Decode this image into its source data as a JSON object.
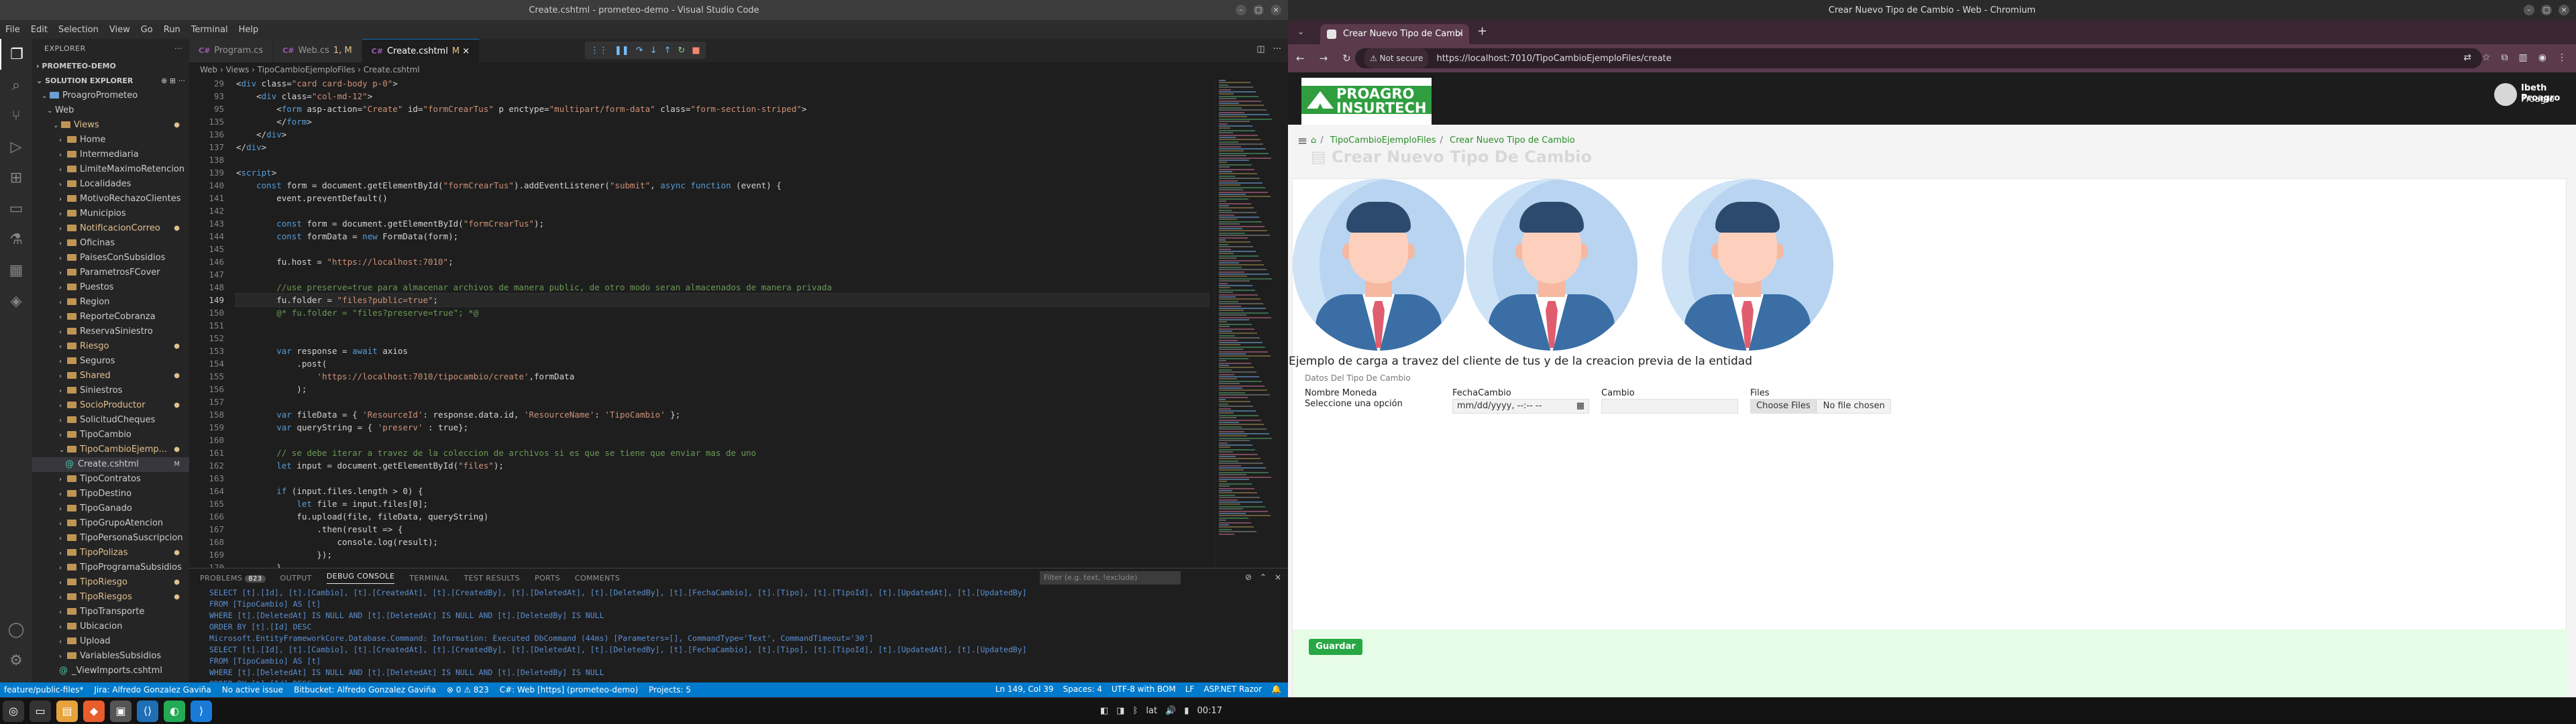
{
  "vscode": {
    "window_title": "Create.cshtml - prometeo-demo - Visual Studio Code",
    "menu": [
      "File",
      "Edit",
      "Selection",
      "View",
      "Go",
      "Run",
      "Terminal",
      "Help"
    ],
    "explorer_title": "EXPLORER",
    "workspace": "PROMETEO-DEMO",
    "solution_explorer": "SOLUTION EXPLORER",
    "project": "ProagroPrometeo",
    "tree": [
      {
        "label": "Web",
        "indent": 2,
        "open": true,
        "folder": false
      },
      {
        "label": "Views",
        "indent": 3,
        "open": true,
        "folder": true,
        "mod": true
      },
      {
        "label": "Home",
        "indent": 4,
        "folder": true
      },
      {
        "label": "Intermediaria",
        "indent": 4,
        "folder": true
      },
      {
        "label": "LimiteMaximoRetencion",
        "indent": 4,
        "folder": true
      },
      {
        "label": "Localidades",
        "indent": 4,
        "folder": true
      },
      {
        "label": "MotivoRechazoClientes",
        "indent": 4,
        "folder": true
      },
      {
        "label": "Municipios",
        "indent": 4,
        "folder": true
      },
      {
        "label": "NotificacionCorreo",
        "indent": 4,
        "folder": true,
        "mod": true
      },
      {
        "label": "Oficinas",
        "indent": 4,
        "folder": true
      },
      {
        "label": "PaisesConSubsidios",
        "indent": 4,
        "folder": true
      },
      {
        "label": "ParametrosFCover",
        "indent": 4,
        "folder": true
      },
      {
        "label": "Puestos",
        "indent": 4,
        "folder": true
      },
      {
        "label": "Region",
        "indent": 4,
        "folder": true
      },
      {
        "label": "ReporteCobranza",
        "indent": 4,
        "folder": true
      },
      {
        "label": "ReservaSiniestro",
        "indent": 4,
        "folder": true
      },
      {
        "label": "Riesgo",
        "indent": 4,
        "folder": true,
        "mod": true
      },
      {
        "label": "Seguros",
        "indent": 4,
        "folder": true
      },
      {
        "label": "Shared",
        "indent": 4,
        "folder": true,
        "mod": true
      },
      {
        "label": "Siniestros",
        "indent": 4,
        "folder": true
      },
      {
        "label": "SocioProductor",
        "indent": 4,
        "folder": true,
        "mod": true
      },
      {
        "label": "SolicitudCheques",
        "indent": 4,
        "folder": true
      },
      {
        "label": "TipoCambio",
        "indent": 4,
        "folder": true
      },
      {
        "label": "TipoCambioEjemp...",
        "indent": 4,
        "folder": true,
        "open": true,
        "mod": true
      },
      {
        "label": "Create.cshtml",
        "indent": 5,
        "file": true,
        "sel": true,
        "badge": "M"
      },
      {
        "label": "TipoContratos",
        "indent": 4,
        "folder": true
      },
      {
        "label": "TipoDestino",
        "indent": 4,
        "folder": true
      },
      {
        "label": "TipoGanado",
        "indent": 4,
        "folder": true
      },
      {
        "label": "TipoGrupoAtencion",
        "indent": 4,
        "folder": true
      },
      {
        "label": "TipoPersonaSuscripcion",
        "indent": 4,
        "folder": true
      },
      {
        "label": "TipoPolizas",
        "indent": 4,
        "folder": true,
        "mod": true
      },
      {
        "label": "TipoProgramaSubsidios",
        "indent": 4,
        "folder": true
      },
      {
        "label": "TipoRiesgo",
        "indent": 4,
        "folder": true,
        "mod": true
      },
      {
        "label": "TipoRiesgos",
        "indent": 4,
        "folder": true,
        "mod": true
      },
      {
        "label": "TipoTransporte",
        "indent": 4,
        "folder": true
      },
      {
        "label": "Ubicacion",
        "indent": 4,
        "folder": true
      },
      {
        "label": "Upload",
        "indent": 4,
        "folder": true
      },
      {
        "label": "VariablesSubsidios",
        "indent": 4,
        "folder": true
      },
      {
        "label": "_ViewImports.cshtml",
        "indent": 4,
        "file": true
      }
    ],
    "tabs": [
      {
        "icon": "C#",
        "label": "Program.cs",
        "status": ""
      },
      {
        "icon": "C#",
        "label": "Web.cs",
        "status": "1, M"
      },
      {
        "icon": "C#",
        "label": "Create.cshtml",
        "status": "M",
        "active": true
      }
    ],
    "breadcrumb": "Web › Views › TipoCambioEjemploFiles › Create.cshtml",
    "line_numbers": [
      "29",
      "93",
      "95",
      "135",
      "136",
      "137",
      "138",
      "139",
      "140",
      "141",
      "142",
      "143",
      "144",
      "145",
      "146",
      "147",
      "148",
      "149",
      "150",
      "151",
      "152",
      "153",
      "154",
      "155",
      "156",
      "157",
      "158",
      "159",
      "160",
      "161",
      "162",
      "163",
      "164",
      "165",
      "166",
      "167",
      "168",
      "169",
      "170"
    ],
    "current_line": "149",
    "code_lines": [
      "<div class=\"card card-body p-0\">",
      "    <div class=\"col-md-12\">",
      "        <form asp-action=\"Create\" id=\"formCrearTus\" p enctype=\"multipart/form-data\" class=\"form-section-striped\">",
      "        </form>",
      "    </div>",
      "</div>",
      "",
      "<script>",
      "    const form = document.getElementById(\"formCrearTus\").addEventListener(\"submit\", async function (event) {",
      "        event.preventDefault()",
      "",
      "        const form = document.getElementById(\"formCrearTus\");",
      "        const formData = new FormData(form);",
      "",
      "        fu.host = \"https://localhost:7010\";",
      "",
      "        //use preserve=true para almacenar archivos de manera public, de otro modo seran almacenados de manera privada",
      "        fu.folder = \"files?public=true\";",
      "        @* fu.folder = \"files?preserve=true\"; *@",
      "",
      "",
      "        var response = await axios",
      "            .post(",
      "                'https://localhost:7010/tipocambio/create',formData",
      "            );",
      "",
      "        var fileData = { 'ResourceId': response.data.id, 'ResourceName': 'TipoCambio' };",
      "        var queryString = { 'preserv' : true};",
      "",
      "        // se debe iterar a travez de la coleccion de archivos si es que se tiene que enviar mas de uno",
      "        let input = document.getElementById(\"files\");",
      "",
      "        if (input.files.length > 0) {",
      "            let file = input.files[0];",
      "            fu.upload(file, fileData, queryString)",
      "                .then(result => {",
      "                    console.log(result);",
      "                });",
      "        }"
    ],
    "panel_tabs": [
      "PROBLEMS",
      "OUTPUT",
      "DEBUG CONSOLE",
      "TERMINAL",
      "TEST RESULTS",
      "PORTS",
      "COMMENTS"
    ],
    "problems_count": "823",
    "panel_filter_placeholder": "Filter (e.g. text, !exclude)",
    "panel_lines": [
      "SELECT [t].[Id], [t].[Cambio], [t].[CreatedAt], [t].[CreatedBy], [t].[DeletedAt], [t].[DeletedBy], [t].[FechaCambio], [t].[Tipo], [t].[TipoId], [t].[UpdatedAt], [t].[UpdatedBy]",
      "FROM [TipoCambio] AS [t]",
      "WHERE [t].[DeletedAt] IS NULL AND [t].[DeletedAt] IS NULL AND [t].[DeletedBy] IS NULL",
      "ORDER BY [t].[Id] DESC",
      "Microsoft.EntityFrameworkCore.Database.Command: Information: Executed DbCommand (44ms) [Parameters=[], CommandType='Text', CommandTimeout='30']",
      "SELECT [t].[Id], [t].[Cambio], [t].[CreatedAt], [t].[CreatedBy], [t].[DeletedAt], [t].[DeletedBy], [t].[FechaCambio], [t].[Tipo], [t].[TipoId], [t].[UpdatedAt], [t].[UpdatedBy]",
      "FROM [TipoCambio] AS [t]",
      "WHERE [t].[DeletedAt] IS NULL AND [t].[DeletedAt] IS NULL AND [t].[DeletedBy] IS NULL",
      "ORDER BY [t].[Id] DESC"
    ],
    "status": {
      "branch": "feature/public-files*",
      "jira": "Jira: Alfredo Gonzalez Gaviña",
      "issue": "No active issue",
      "bitbucket": "Bitbucket: Alfredo Gonzalez Gaviña",
      "problems": "⊗ 0 ⚠ 823",
      "run": "C#: Web [https] (prometeo-demo)",
      "projects": "Projects: 5",
      "position": "Ln 149, Col 39",
      "spaces": "Spaces: 4",
      "encoding": "UTF-8 with BOM",
      "eol": "LF",
      "lang": "ASP.NET Razor"
    }
  },
  "chrome": {
    "window_title": "Crear Nuevo Tipo de Cambio - Web - Chromium",
    "tab_title": "Crear Nuevo Tipo de Cambi",
    "not_secure": "Not secure",
    "url": "https://localhost:7010/TipoCambioEjemploFiles/create",
    "logo_text": "PROAGRO INSURTECH",
    "user_name": "Ibeth Proagro",
    "user_role": "Proagro",
    "breadcrumb_1": "TipoCambioEjemploFiles",
    "breadcrumb_2": "Crear Nuevo Tipo de Cambio",
    "page_title": "Crear Nuevo Tipo De Cambio",
    "caption": "Ejemplo de carga a travez del cliente de tus y de la creacion previa de la entidad",
    "legend": "Datos Del Tipo De Cambio",
    "label_moneda": "Nombre Moneda",
    "select_moneda": "Seleccione una opción",
    "label_fecha": "FechaCambio",
    "fecha_placeholder": "mm/dd/yyyy, --:-- --",
    "label_cambio": "Cambio",
    "label_files": "Files",
    "choose_files": "Choose Files",
    "no_file": "No file chosen",
    "save_button": "Guardar"
  },
  "taskbar": {
    "lang": "lat",
    "time": "00:17"
  },
  "colors": {
    "vscode_status": "#007acc",
    "brand_green": "#2e9e3e",
    "save_green": "#28a745",
    "footer_bg": "#e7fce6"
  }
}
